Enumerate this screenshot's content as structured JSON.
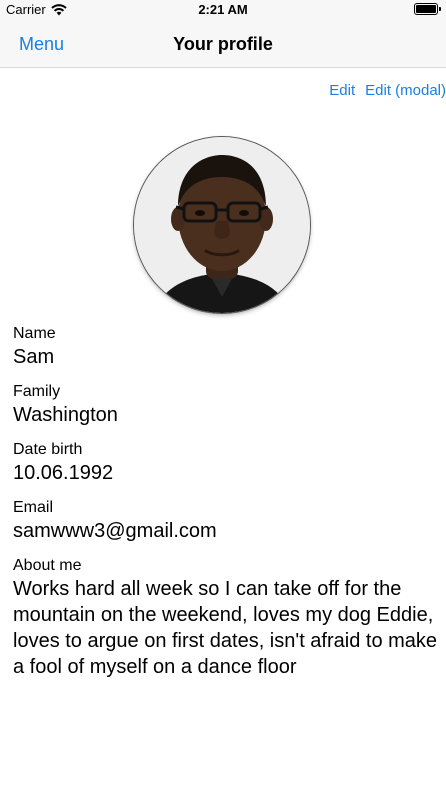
{
  "status_bar": {
    "carrier": "Carrier",
    "time": "2:21 AM"
  },
  "nav": {
    "back_label": "Menu",
    "title": "Your profile"
  },
  "actions": {
    "edit_label": "Edit",
    "edit_modal_label": "Edit (modal)"
  },
  "profile": {
    "fields": [
      {
        "label": "Name",
        "value": "Sam"
      },
      {
        "label": "Family",
        "value": "Washington"
      },
      {
        "label": "Date birth",
        "value": "10.06.1992"
      },
      {
        "label": "Email",
        "value": "samwww3@gmail.com"
      },
      {
        "label": "About me",
        "value": "Works hard all week so I can take off for the mountain on the weekend, loves my dog Eddie, loves to argue on first dates, isn't afraid to make a fool of myself on a dance floor"
      }
    ]
  },
  "colors": {
    "accent": "#1a7fe3",
    "bar_background": "#f7f7f7"
  }
}
